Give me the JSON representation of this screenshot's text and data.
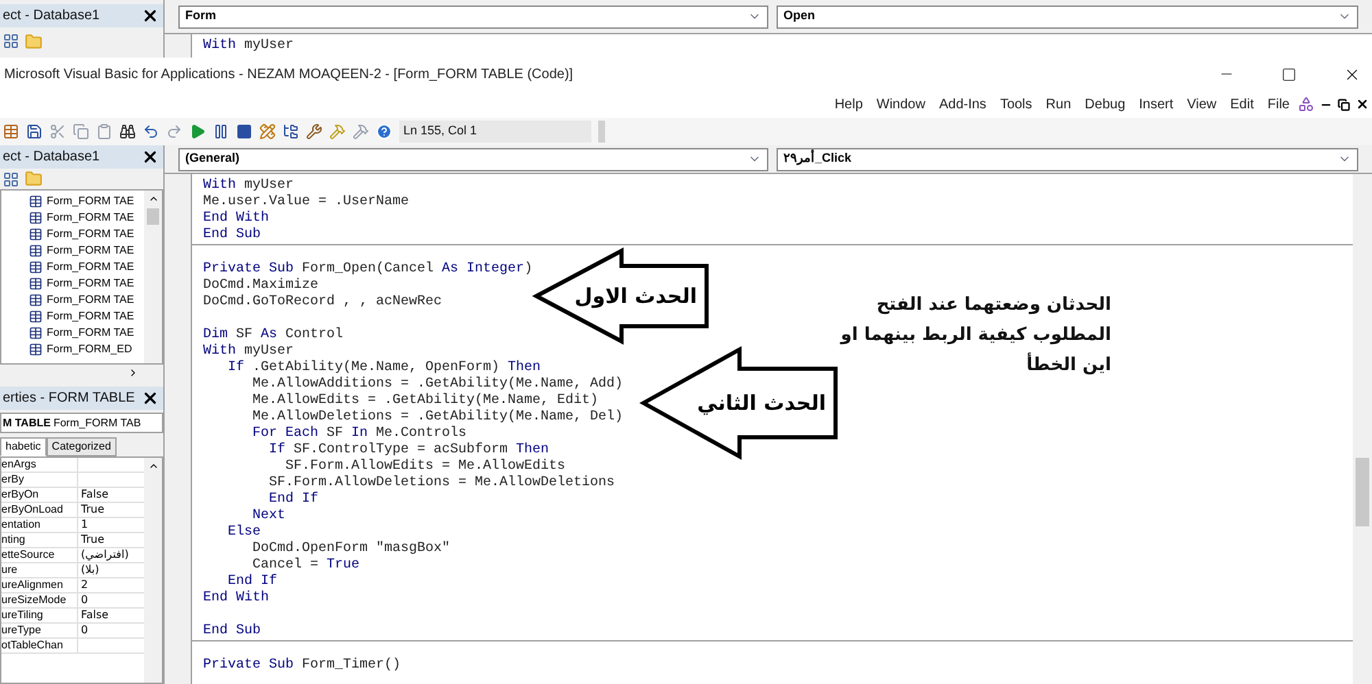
{
  "background_window": {
    "project_title": "ect - Database1",
    "object_dropdown": "Form",
    "procedure_dropdown": "Open",
    "code_line": [
      {
        "text": "With",
        "kind": "keyword"
      },
      {
        "text": " myUser",
        "kind": "plain"
      }
    ]
  },
  "window": {
    "title": "Microsoft Visual Basic for Applications - NEZAM MOAQEEN-2 - [Form_FORM TABLE (Code)]"
  },
  "menu": [
    "Help",
    "Window",
    "Add-Ins",
    "Tools",
    "Run",
    "Debug",
    "Insert",
    "View",
    "Edit",
    "File"
  ],
  "toolbar": {
    "position": "Ln 155, Col 1"
  },
  "project": {
    "title": "ect - Database1",
    "items": [
      "Form_FORM TAE",
      "Form_FORM TAE",
      "Form_FORM TAE",
      "Form_FORM TAE",
      "Form_FORM TAE",
      "Form_FORM TAE",
      "Form_FORM TAE",
      "Form_FORM TAE",
      "Form_FORM TAE",
      "Form_FORM_ED"
    ]
  },
  "properties": {
    "title": "erties - FORM TABLE",
    "object": "M TABLE",
    "object_type": "Form_FORM TAB",
    "tabs": [
      {
        "label": "habetic",
        "selected": true
      },
      {
        "label": "Categorized",
        "selected": false
      }
    ],
    "rows": [
      {
        "name": "enArgs"
      },
      {
        "name": "erBy"
      },
      {
        "name": "erByOn",
        "value": "False"
      },
      {
        "name": "erByOnLoad",
        "value": "True"
      },
      {
        "name": "entation",
        "value": "1"
      },
      {
        "name": "nting",
        "value": "True"
      },
      {
        "name": "etteSource",
        "value": "(افتراضي)"
      },
      {
        "name": "ure",
        "value": "(بلا)"
      },
      {
        "name": "ureAlignmen",
        "value": "2"
      },
      {
        "name": "ureSizeMode",
        "value": "0"
      },
      {
        "name": "ureTiling",
        "value": "False"
      },
      {
        "name": "ureType",
        "value": "0"
      },
      {
        "name": "otTableChan"
      }
    ]
  },
  "code": {
    "object_dropdown": "(General)",
    "procedure_dropdown": "أمر٢٩_Click",
    "procedures": [
      {
        "lines": [
          {
            "kind": "code",
            "parts": [
              {
                "text": "With",
                "kind": "keyword"
              },
              {
                "text": " myUser",
                "kind": "plain"
              }
            ]
          },
          {
            "kind": "code",
            "parts": [
              {
                "text": "Me.user.Value = .UserName",
                "kind": "plain"
              }
            ]
          },
          {
            "kind": "code",
            "parts": [
              {
                "text": "End With",
                "kind": "keyword"
              }
            ]
          },
          {
            "kind": "code",
            "parts": [
              {
                "text": "End Sub",
                "kind": "keyword"
              }
            ]
          }
        ]
      },
      {
        "lines": [
          {
            "kind": "blank"
          },
          {
            "kind": "code",
            "parts": [
              {
                "text": "Private Sub",
                "kind": "keyword"
              },
              {
                "text": " Form_Open(Cancel ",
                "kind": "plain"
              },
              {
                "text": "As Integer",
                "kind": "keyword"
              },
              {
                "text": ")",
                "kind": "plain"
              }
            ]
          },
          {
            "kind": "code",
            "parts": [
              {
                "text": "DoCmd.Maximize",
                "kind": "plain"
              }
            ]
          },
          {
            "kind": "code",
            "parts": [
              {
                "text": "DoCmd.GoToRecord , , acNewRec",
                "kind": "plain"
              }
            ]
          },
          {
            "kind": "blank"
          },
          {
            "kind": "code",
            "parts": [
              {
                "text": "Dim",
                "kind": "keyword"
              },
              {
                "text": " SF ",
                "kind": "plain"
              },
              {
                "text": "As",
                "kind": "keyword"
              },
              {
                "text": " Control",
                "kind": "plain"
              }
            ]
          },
          {
            "kind": "code",
            "parts": [
              {
                "text": "With",
                "kind": "keyword"
              },
              {
                "text": " myUser",
                "kind": "plain"
              }
            ]
          },
          {
            "kind": "code",
            "parts": [
              {
                "text": "   If",
                "kind": "keyword"
              },
              {
                "text": " .GetAbility(Me.Name, OpenForm) ",
                "kind": "plain"
              },
              {
                "text": "Then",
                "kind": "keyword"
              }
            ]
          },
          {
            "kind": "code",
            "parts": [
              {
                "text": "      Me.AllowAdditions = .GetAbility(Me.Name, Add)",
                "kind": "plain"
              }
            ]
          },
          {
            "kind": "code",
            "parts": [
              {
                "text": "      Me.AllowEdits = .GetAbility(Me.Name, Edit)",
                "kind": "plain"
              }
            ]
          },
          {
            "kind": "code",
            "parts": [
              {
                "text": "      Me.AllowDeletions = .GetAbility(Me.Name, Del)",
                "kind": "plain"
              }
            ]
          },
          {
            "kind": "code",
            "parts": [
              {
                "text": "      For Each",
                "kind": "keyword"
              },
              {
                "text": " SF ",
                "kind": "plain"
              },
              {
                "text": "In",
                "kind": "keyword"
              },
              {
                "text": " Me.Controls",
                "kind": "plain"
              }
            ]
          },
          {
            "kind": "code",
            "parts": [
              {
                "text": "        If",
                "kind": "keyword"
              },
              {
                "text": " SF.ControlType = acSubform ",
                "kind": "plain"
              },
              {
                "text": "Then",
                "kind": "keyword"
              }
            ]
          },
          {
            "kind": "code",
            "parts": [
              {
                "text": "          SF.Form.AllowEdits = Me.AllowEdits",
                "kind": "plain"
              }
            ]
          },
          {
            "kind": "code",
            "parts": [
              {
                "text": "        SF.Form.AllowDeletions = Me.AllowDeletions",
                "kind": "plain"
              }
            ]
          },
          {
            "kind": "code",
            "parts": [
              {
                "text": "        End If",
                "kind": "keyword"
              }
            ]
          },
          {
            "kind": "code",
            "parts": [
              {
                "text": "      Next",
                "kind": "keyword"
              }
            ]
          },
          {
            "kind": "code",
            "parts": [
              {
                "text": "   Else",
                "kind": "keyword"
              }
            ]
          },
          {
            "kind": "code",
            "parts": [
              {
                "text": "      DoCmd.OpenForm \"masgBox\"",
                "kind": "plain"
              }
            ]
          },
          {
            "kind": "code",
            "parts": [
              {
                "text": "      Cancel = ",
                "kind": "plain"
              },
              {
                "text": "True",
                "kind": "keyword"
              }
            ]
          },
          {
            "kind": "code",
            "parts": [
              {
                "text": "   End If",
                "kind": "keyword"
              }
            ]
          },
          {
            "kind": "code",
            "parts": [
              {
                "text": "End With",
                "kind": "keyword"
              }
            ]
          },
          {
            "kind": "blank"
          },
          {
            "kind": "code",
            "parts": [
              {
                "text": "End Sub",
                "kind": "keyword"
              }
            ]
          }
        ]
      },
      {
        "lines": [
          {
            "kind": "blank"
          },
          {
            "kind": "code",
            "parts": [
              {
                "text": "Private Sub",
                "kind": "keyword"
              },
              {
                "text": " Form_Timer()",
                "kind": "plain"
              }
            ]
          }
        ]
      }
    ]
  },
  "annotations": [
    {
      "text": "الحدث الاول"
    },
    {
      "text": "الحدث الثاني"
    }
  ],
  "note": {
    "lines": [
      "الحدثان وضعتهما عند الفتح",
      "المطلوب كيفية الربط بينهما او",
      "اين الخطأ"
    ]
  }
}
